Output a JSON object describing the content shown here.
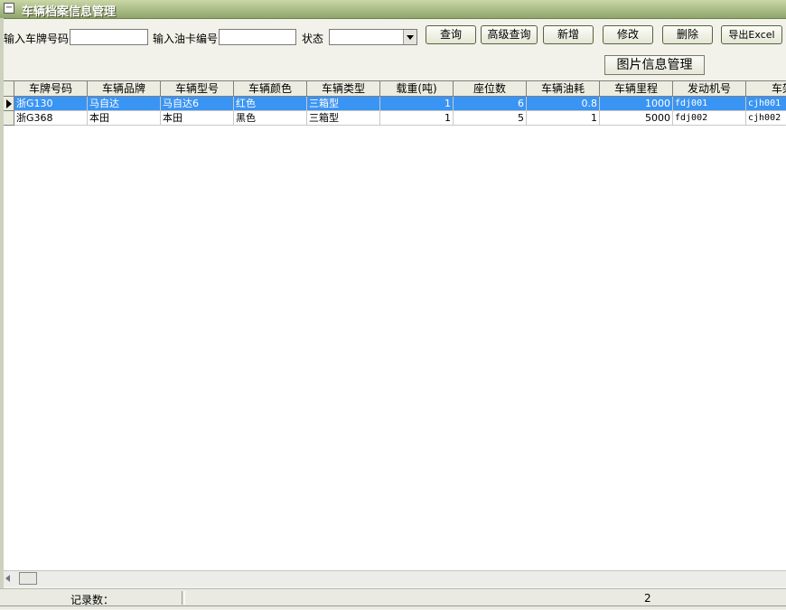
{
  "window": {
    "title": "车辆档案信息管理"
  },
  "search": {
    "plate_label": "输入车牌号码",
    "plate_value": "",
    "fuelcard_label": "输入油卡编号",
    "fuelcard_value": "",
    "status_label": "状态",
    "status_value": ""
  },
  "toolbar": {
    "query": "查询",
    "advanced_query": "高级查询",
    "add": "新增",
    "edit": "修改",
    "delete": "删除",
    "export": "导出Excel",
    "image_manage": "图片信息管理"
  },
  "table": {
    "columns": [
      "车牌号码",
      "车辆品牌",
      "车辆型号",
      "车辆颜色",
      "车辆类型",
      "载重(吨)",
      "座位数",
      "车辆油耗",
      "车辆里程",
      "发动机号",
      "车架"
    ],
    "rows": [
      [
        "浙G130",
        "马自达",
        "马自达6",
        "红色",
        "三箱型",
        "1",
        "6",
        "0.8",
        "1000",
        "fdj001",
        "cjh001"
      ],
      [
        "浙G368",
        "本田",
        "本田",
        "黑色",
        "三箱型",
        "1",
        "5",
        "1",
        "5000",
        "fdj002",
        "cjh002"
      ]
    ],
    "selected_row": 0
  },
  "status": {
    "record_label": "记录数：",
    "record_count": "2"
  },
  "colors": {
    "title_bar": "#8fa56a",
    "selection": "#3a94f3",
    "background": "#f2f2ea"
  }
}
